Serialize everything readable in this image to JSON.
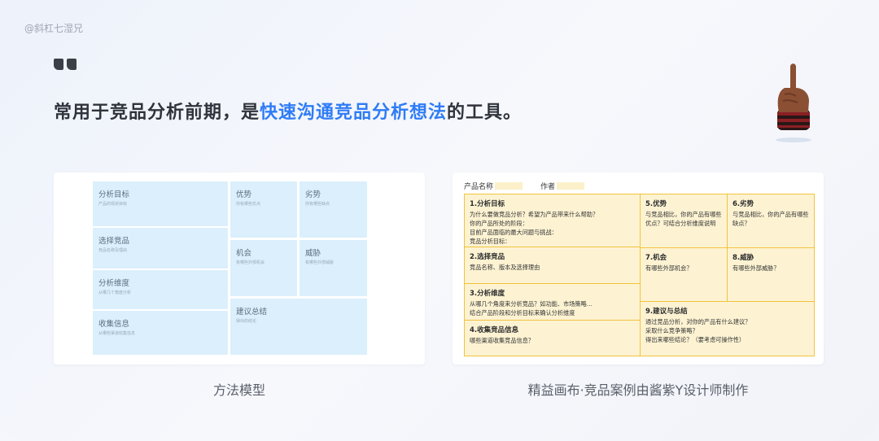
{
  "watermark": "@斜杠七湿兄",
  "headline": {
    "pre": "常用于竞品分析前期，是",
    "highlight": "快速沟通竞品分析想法",
    "post": "的工具。"
  },
  "colors": {
    "accent": "#2f7cf6",
    "left_cell": "#dbeffc",
    "right_cell": "#fdf3d3",
    "right_border": "#f1c33c"
  },
  "left_canvas": {
    "caption": "方法模型",
    "cells": {
      "goal": {
        "title": "分析目标",
        "sub": "产品的现状目标"
      },
      "select": {
        "title": "选择竞品",
        "sub": "竞品名称及理由"
      },
      "dimension": {
        "title": "分析维度",
        "sub": "从哪几个角度分析"
      },
      "collect": {
        "title": "收集信息",
        "sub": "从哪些渠道收集信息"
      },
      "strength": {
        "title": "优势",
        "sub": "你有哪些优点"
      },
      "weakness": {
        "title": "劣势",
        "sub": "你有哪些缺点"
      },
      "opportunity": {
        "title": "机会",
        "sub": "有哪些外部机会"
      },
      "threat": {
        "title": "威胁",
        "sub": "有哪些外部威胁"
      },
      "summary": {
        "title": "建议总结",
        "sub": "得出的结论"
      }
    }
  },
  "right_canvas": {
    "caption": "精益画布·竞品案例由酱紫Y设计师制作",
    "product_label": "产品名称",
    "author_label": "作者",
    "cells": {
      "goal": {
        "title": "1.分析目标",
        "lines": [
          "为什么要做竞品分析？希望为产品带来什么帮助？",
          "你的产品所处的阶段：",
          "目前产品面临的最大问题与挑战：",
          "竞品分析目标："
        ]
      },
      "select": {
        "title": "2.选择竞品",
        "lines": [
          "竞品名称、版本及选择理由"
        ]
      },
      "dimension": {
        "title": "3.分析维度",
        "lines": [
          "从哪几个角度来分析竞品？如功能、市场策略…",
          "结合产品阶段和分析目标来确认分析维度"
        ]
      },
      "collect": {
        "title": "4.收集竞品信息",
        "lines": [
          "哪些渠道收集竞品信息？"
        ]
      },
      "strength": {
        "title": "5.优势",
        "lines": [
          "与竞品相比，你的产品有哪些",
          "优点？可结合分析维度说明"
        ]
      },
      "weakness": {
        "title": "6.劣势",
        "lines": [
          "与竞品相比，你的产品有哪些",
          "缺点？"
        ]
      },
      "opportunity": {
        "title": "7.机会",
        "lines": [
          "有哪些外部机会？"
        ]
      },
      "threat": {
        "title": "8.威胁",
        "lines": [
          "有哪些外部威胁？"
        ]
      },
      "summary": {
        "title": "9.建议与总结",
        "lines": [
          "通过竞品分析，对你的产品有什么建议？",
          "采取什么竞争策略？",
          "得出来哪些结论？（要考虑可操作性）"
        ]
      }
    }
  }
}
